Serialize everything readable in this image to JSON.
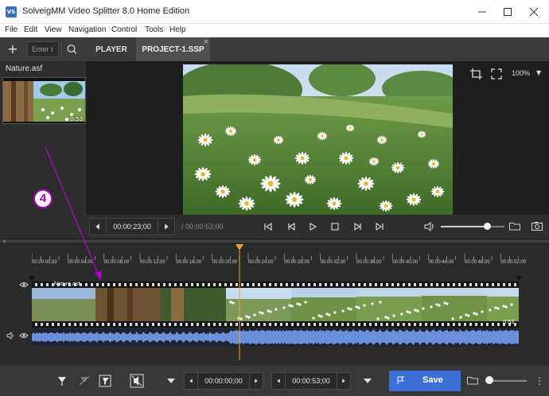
{
  "window": {
    "title": "SolveigMM Video Splitter 8.0 Home Edition",
    "icon_text": "VS"
  },
  "menu": [
    "File",
    "Edit",
    "View",
    "Navigation",
    "Control",
    "Tools",
    "Help"
  ],
  "toolbar": {
    "add_label": "+",
    "search_placeholder": "Enter t",
    "tabs": [
      {
        "label": "PLAYER",
        "active": false
      },
      {
        "label": "PROJECT-1.SSP",
        "active": true
      }
    ],
    "tab_close": "×"
  },
  "library": {
    "file_name": "Nature.asf",
    "duration": "0:53"
  },
  "viewer": {
    "zoom": "100%",
    "zoom_arrow": "▼"
  },
  "transport": {
    "current_time": "00:00:23;00",
    "total_time": "/ 00:00:53;00",
    "volume": 0.72
  },
  "annotation": {
    "number": "4",
    "color": "#b000c8"
  },
  "timeline": {
    "ticks": [
      "00:00:00;00",
      "00:00:04;00",
      "00:00:08;00",
      "00:00:12;00",
      "00:00:16;00",
      "00:00:20;00",
      "00:00:24;00",
      "00:00:28;00",
      "00:00:32;00",
      "00:00:36;00",
      "00:00:40;00",
      "00:00:44;00",
      "00:00:48;00",
      "00:00:52;00"
    ],
    "clip_name": "Nature.asf",
    "clip_duration": "0:53",
    "playhead_time_seconds": 23,
    "total_seconds": 53,
    "playhead_color": "#f0a030",
    "waveform_color": "#6b8fd8"
  },
  "bottombar": {
    "start_time": "00:00:00;00",
    "end_time": "00:00:53;00",
    "save_label": "Save",
    "save_color": "#3d6fd6",
    "more_label": "⋮"
  }
}
